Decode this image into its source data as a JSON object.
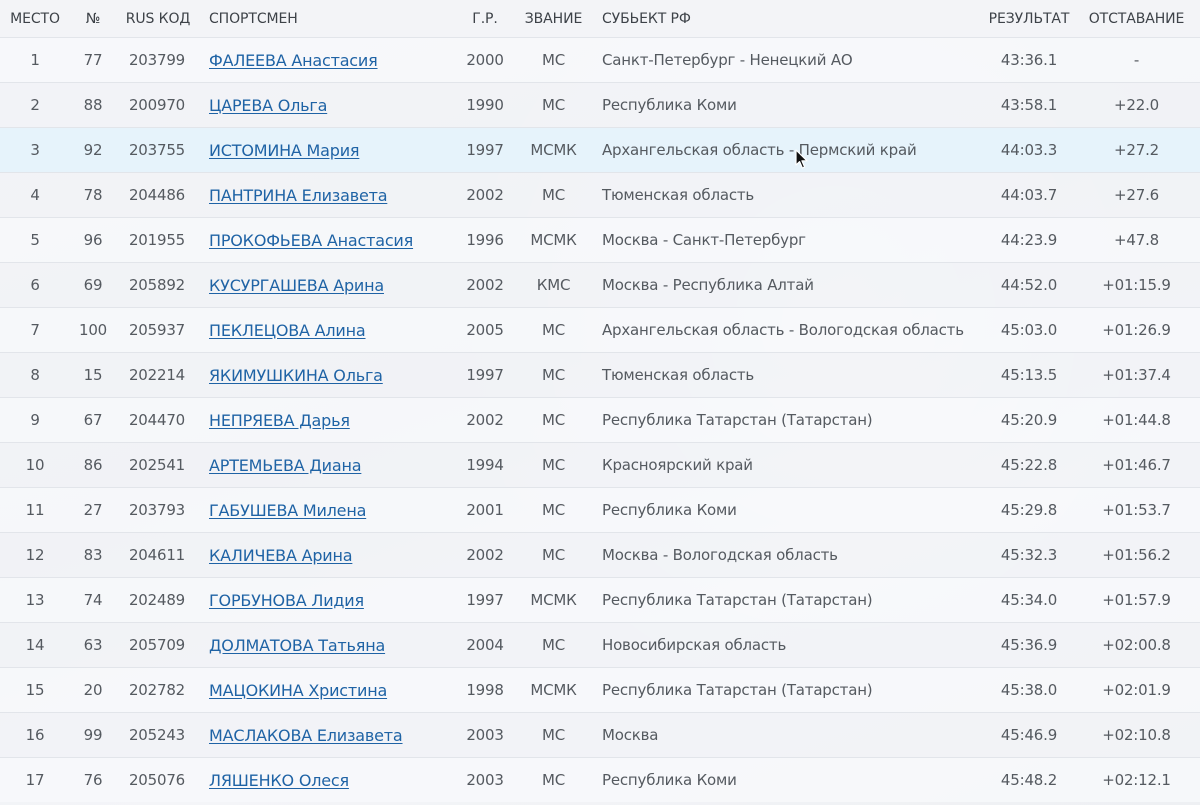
{
  "table": {
    "headers": {
      "place": "МЕСТО",
      "bib": "№",
      "rus_code": "RUS КОД",
      "athlete": "СПОРТСМЕН",
      "birth_year": "Г.Р.",
      "rank": "ЗВАНИЕ",
      "region": "СУБЬЕКТ РФ",
      "result": "РЕЗУЛЬТАТ",
      "behind": "ОТСТАВАНИЕ"
    },
    "rows": [
      {
        "place": "1",
        "bib": "77",
        "rus_code": "203799",
        "athlete": "ФАЛЕЕВА Анастасия",
        "birth_year": "2000",
        "rank": "МС",
        "region": "Санкт-Петербург - Ненецкий АО",
        "result": "43:36.1",
        "behind": "-"
      },
      {
        "place": "2",
        "bib": "88",
        "rus_code": "200970",
        "athlete": "ЦАРЕВА Ольга",
        "birth_year": "1990",
        "rank": "МС",
        "region": "Республика Коми",
        "result": "43:58.1",
        "behind": "+22.0"
      },
      {
        "place": "3",
        "bib": "92",
        "rus_code": "203755",
        "athlete": "ИСТОМИНА Мария",
        "birth_year": "1997",
        "rank": "МСМК",
        "region": "Архангельская область - Пермский край",
        "result": "44:03.3",
        "behind": "+27.2"
      },
      {
        "place": "4",
        "bib": "78",
        "rus_code": "204486",
        "athlete": "ПАНТРИНА Елизавета",
        "birth_year": "2002",
        "rank": "МС",
        "region": "Тюменская область",
        "result": "44:03.7",
        "behind": "+27.6"
      },
      {
        "place": "5",
        "bib": "96",
        "rus_code": "201955",
        "athlete": "ПРОКОФЬЕВА Анастасия",
        "birth_year": "1996",
        "rank": "МСМК",
        "region": "Москва - Санкт-Петербург",
        "result": "44:23.9",
        "behind": "+47.8"
      },
      {
        "place": "6",
        "bib": "69",
        "rus_code": "205892",
        "athlete": "КУСУРГАШЕВА Арина",
        "birth_year": "2002",
        "rank": "КМС",
        "region": "Москва - Республика Алтай",
        "result": "44:52.0",
        "behind": "+01:15.9"
      },
      {
        "place": "7",
        "bib": "100",
        "rus_code": "205937",
        "athlete": "ПЕКЛЕЦОВА Алина",
        "birth_year": "2005",
        "rank": "МС",
        "region": "Архангельская область - Вологодская область",
        "result": "45:03.0",
        "behind": "+01:26.9"
      },
      {
        "place": "8",
        "bib": "15",
        "rus_code": "202214",
        "athlete": "ЯКИМУШКИНА Ольга",
        "birth_year": "1997",
        "rank": "МС",
        "region": "Тюменская область",
        "result": "45:13.5",
        "behind": "+01:37.4"
      },
      {
        "place": "9",
        "bib": "67",
        "rus_code": "204470",
        "athlete": "НЕПРЯЕВА Дарья",
        "birth_year": "2002",
        "rank": "МС",
        "region": "Республика Татарстан (Татарстан)",
        "result": "45:20.9",
        "behind": "+01:44.8"
      },
      {
        "place": "10",
        "bib": "86",
        "rus_code": "202541",
        "athlete": "АРТЕМЬЕВА Диана",
        "birth_year": "1994",
        "rank": "МС",
        "region": "Красноярский край",
        "result": "45:22.8",
        "behind": "+01:46.7"
      },
      {
        "place": "11",
        "bib": "27",
        "rus_code": "203793",
        "athlete": "ГАБУШЕВА Милена",
        "birth_year": "2001",
        "rank": "МС",
        "region": "Республика Коми",
        "result": "45:29.8",
        "behind": "+01:53.7"
      },
      {
        "place": "12",
        "bib": "83",
        "rus_code": "204611",
        "athlete": "КАЛИЧЕВА Арина",
        "birth_year": "2002",
        "rank": "МС",
        "region": "Москва - Вологодская область",
        "result": "45:32.3",
        "behind": "+01:56.2"
      },
      {
        "place": "13",
        "bib": "74",
        "rus_code": "202489",
        "athlete": "ГОРБУНОВА Лидия",
        "birth_year": "1997",
        "rank": "МСМК",
        "region": "Республика Татарстан (Татарстан)",
        "result": "45:34.0",
        "behind": "+01:57.9"
      },
      {
        "place": "14",
        "bib": "63",
        "rus_code": "205709",
        "athlete": "ДОЛМАТОВА Татьяна",
        "birth_year": "2004",
        "rank": "МС",
        "region": "Новосибирская область",
        "result": "45:36.9",
        "behind": "+02:00.8"
      },
      {
        "place": "15",
        "bib": "20",
        "rus_code": "202782",
        "athlete": "МАЦОКИНА Христина",
        "birth_year": "1998",
        "rank": "МСМК",
        "region": "Республика Татарстан (Татарстан)",
        "result": "45:38.0",
        "behind": "+02:01.9"
      },
      {
        "place": "16",
        "bib": "99",
        "rus_code": "205243",
        "athlete": "МАСЛАКОВА Елизавета",
        "birth_year": "2003",
        "rank": "МС",
        "region": "Москва",
        "result": "45:46.9",
        "behind": "+02:10.8"
      },
      {
        "place": "17",
        "bib": "76",
        "rus_code": "205076",
        "athlete": "ЛЯШЕНКО Олеся",
        "birth_year": "2003",
        "rank": "МС",
        "region": "Республика Коми",
        "result": "45:48.2",
        "behind": "+02:12.1"
      }
    ]
  },
  "state": {
    "hovered_row": 3
  },
  "colors": {
    "link": "#1f63a5",
    "hover_row": "#e6f3fb",
    "text": "#555a60",
    "header_text": "#3d4248"
  }
}
